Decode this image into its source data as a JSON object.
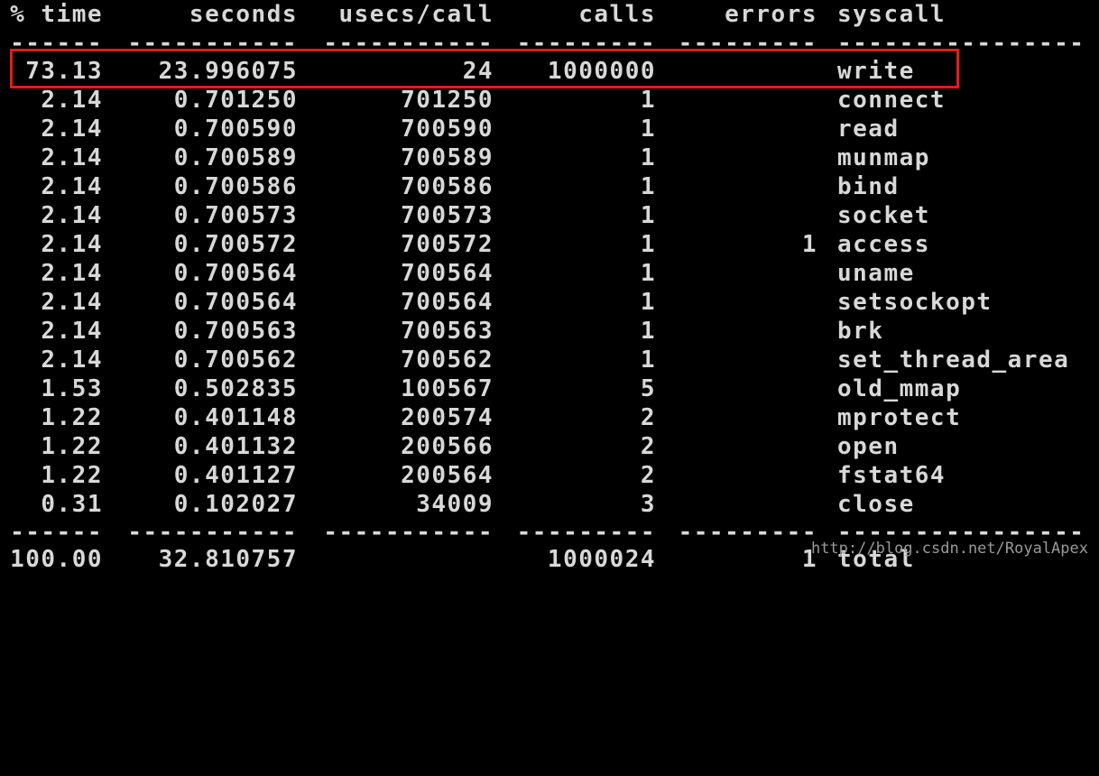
{
  "header": {
    "pct_time": "% time",
    "seconds": "seconds",
    "usecs_call": "usecs/call",
    "calls": "calls",
    "errors": "errors",
    "syscall": "syscall"
  },
  "separator": {
    "pct": "------",
    "seconds": "-----------",
    "usecs": "-----------",
    "calls": "---------",
    "errors": "---------",
    "syscall": "----------------"
  },
  "rows": [
    {
      "pct": "73.13",
      "seconds": "23.996075",
      "usecs": "24",
      "calls": "1000000",
      "errors": "",
      "syscall": "write"
    },
    {
      "pct": "2.14",
      "seconds": "0.701250",
      "usecs": "701250",
      "calls": "1",
      "errors": "",
      "syscall": "connect"
    },
    {
      "pct": "2.14",
      "seconds": "0.700590",
      "usecs": "700590",
      "calls": "1",
      "errors": "",
      "syscall": "read"
    },
    {
      "pct": "2.14",
      "seconds": "0.700589",
      "usecs": "700589",
      "calls": "1",
      "errors": "",
      "syscall": "munmap"
    },
    {
      "pct": "2.14",
      "seconds": "0.700586",
      "usecs": "700586",
      "calls": "1",
      "errors": "",
      "syscall": "bind"
    },
    {
      "pct": "2.14",
      "seconds": "0.700573",
      "usecs": "700573",
      "calls": "1",
      "errors": "",
      "syscall": "socket"
    },
    {
      "pct": "2.14",
      "seconds": "0.700572",
      "usecs": "700572",
      "calls": "1",
      "errors": "1",
      "syscall": "access"
    },
    {
      "pct": "2.14",
      "seconds": "0.700564",
      "usecs": "700564",
      "calls": "1",
      "errors": "",
      "syscall": "uname"
    },
    {
      "pct": "2.14",
      "seconds": "0.700564",
      "usecs": "700564",
      "calls": "1",
      "errors": "",
      "syscall": "setsockopt"
    },
    {
      "pct": "2.14",
      "seconds": "0.700563",
      "usecs": "700563",
      "calls": "1",
      "errors": "",
      "syscall": "brk"
    },
    {
      "pct": "2.14",
      "seconds": "0.700562",
      "usecs": "700562",
      "calls": "1",
      "errors": "",
      "syscall": "set_thread_area"
    },
    {
      "pct": "1.53",
      "seconds": "0.502835",
      "usecs": "100567",
      "calls": "5",
      "errors": "",
      "syscall": "old_mmap"
    },
    {
      "pct": "1.22",
      "seconds": "0.401148",
      "usecs": "200574",
      "calls": "2",
      "errors": "",
      "syscall": "mprotect"
    },
    {
      "pct": "1.22",
      "seconds": "0.401132",
      "usecs": "200566",
      "calls": "2",
      "errors": "",
      "syscall": "open"
    },
    {
      "pct": "1.22",
      "seconds": "0.401127",
      "usecs": "200564",
      "calls": "2",
      "errors": "",
      "syscall": "fstat64"
    },
    {
      "pct": "0.31",
      "seconds": "0.102027",
      "usecs": "34009",
      "calls": "3",
      "errors": "",
      "syscall": "close"
    }
  ],
  "total": {
    "pct": "100.00",
    "seconds": "32.810757",
    "usecs": "",
    "calls": "1000024",
    "errors": "1",
    "syscall": "total"
  },
  "watermark": "http://blog.csdn.net/RoyalApex",
  "colors": {
    "background": "#000000",
    "text": "#d8d8d8",
    "highlight_border": "#d8201f"
  }
}
